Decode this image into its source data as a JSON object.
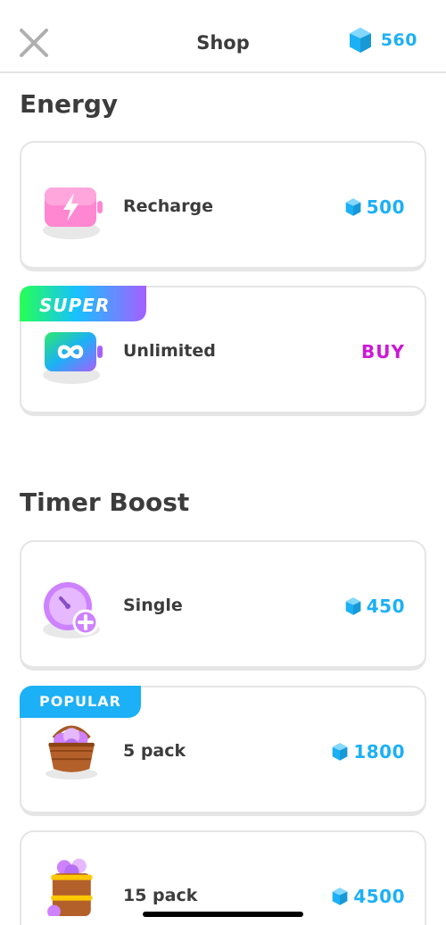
{
  "header": {
    "title": "Shop",
    "gem_count": "560"
  },
  "colors": {
    "gem": "#1cb0f6",
    "super_buy": "#ce18d6",
    "border": "#e5e5e5",
    "text": "#3c3c3c"
  },
  "sections": [
    {
      "title": "Energy"
    },
    {
      "title": "Timer Boost"
    }
  ],
  "energy_items": [
    {
      "label": "Recharge",
      "price": "500",
      "icon": "battery-recharge-icon"
    },
    {
      "label": "Unlimited",
      "action": "BUY",
      "badge": "SUPER",
      "icon": "battery-infinity-icon"
    }
  ],
  "timer_items": [
    {
      "label": "Single",
      "price": "450",
      "icon": "timer-plus-icon"
    },
    {
      "label": "5 pack",
      "price": "1800",
      "badge": "POPULAR",
      "icon": "timer-basket-icon"
    },
    {
      "label": "15 pack",
      "price": "4500",
      "icon": "timer-barrel-icon"
    }
  ]
}
